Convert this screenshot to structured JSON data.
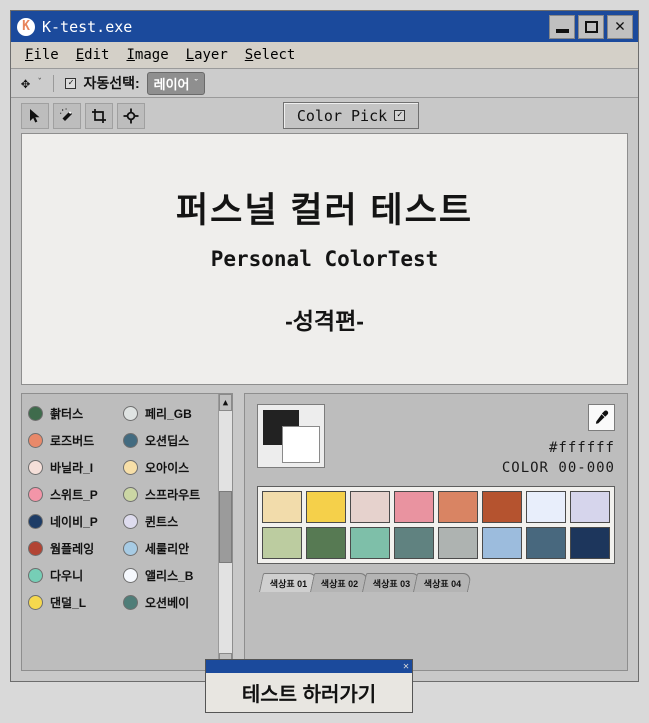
{
  "window": {
    "title": "K-test.exe",
    "icon": "app-k-icon",
    "controls": {
      "minimize": "minimize-icon",
      "maximize": "maximize-icon",
      "close": "✕"
    }
  },
  "menubar": {
    "items": [
      {
        "mnemonic": "F",
        "rest": "ile"
      },
      {
        "mnemonic": "E",
        "rest": "dit"
      },
      {
        "mnemonic": "I",
        "rest": "mage"
      },
      {
        "mnemonic": "L",
        "rest": "ayer"
      },
      {
        "mnemonic": "S",
        "rest": "elect"
      }
    ]
  },
  "options_bar": {
    "move_tool_icon": "move-icon",
    "caret": "ˇ",
    "checkbox_glyph": "☑",
    "auto_select_label": "자동선택:",
    "layer_dropdown_value": "레이어",
    "layer_dropdown_caret": "ˇ"
  },
  "toolbar": {
    "tools": [
      {
        "name": "move-arrow-tool",
        "icon": "arrow-cursor-icon"
      },
      {
        "name": "magic-wand-tool",
        "icon": "magic-wand-icon"
      },
      {
        "name": "crop-tool",
        "icon": "crop-icon"
      },
      {
        "name": "target-tool",
        "icon": "target-crosshair-icon"
      }
    ],
    "color_pick": {
      "label": "Color Pick",
      "checkbox_glyph": "☑"
    }
  },
  "canvas": {
    "title": "퍼스널 컬러 테스트",
    "subtitle": "Personal ColorTest",
    "section": "-성격편-"
  },
  "color_list": {
    "left_column": [
      {
        "name": "촭터스",
        "color": "#3f6b4c"
      },
      {
        "name": "로즈버드",
        "color": "#e8896a"
      },
      {
        "name": "바닐라_I",
        "color": "#f5dfd9"
      },
      {
        "name": "스위트_P",
        "color": "#f395a8"
      },
      {
        "name": "네이비_P",
        "color": "#1d3c66"
      },
      {
        "name": "웜플레잉",
        "color": "#b24434"
      },
      {
        "name": "다우니",
        "color": "#76ceb6"
      },
      {
        "name": "댄덜_L",
        "color": "#f5d84e"
      }
    ],
    "right_column": [
      {
        "name": "페리_GB",
        "color": "#dfe3e2"
      },
      {
        "name": "오션딥스",
        "color": "#436b80"
      },
      {
        "name": "오아이스",
        "color": "#f7dfa8"
      },
      {
        "name": "스프라우트",
        "color": "#cbd6a4"
      },
      {
        "name": "퀸트스",
        "color": "#dedcee"
      },
      {
        "name": "세룰리안",
        "color": "#a7cbe4"
      },
      {
        "name": "앨리스_B",
        "color": "#f5f8fd"
      },
      {
        "name": "오션베이",
        "color": "#4f7d78"
      }
    ],
    "scrollbar": {
      "up_arrow": "▲",
      "down_arrow": "▼"
    }
  },
  "color_picker": {
    "foreground": "#222222",
    "background": "#ffffff",
    "eyedropper_icon": "eyedropper-icon",
    "hex_value": "#ffffff",
    "color_number": "COLOR 00-000",
    "swatches": [
      "#f2dcab",
      "#f5d04a",
      "#e6d2cd",
      "#e993a0",
      "#d98463",
      "#b5532f",
      "#e8eefb",
      "#d6d5ec",
      "#bcccA0",
      "#577a53",
      "#7ebfa9",
      "#608280",
      "#aeb3b1",
      "#9cbcdd",
      "#48687e",
      "#1d365c"
    ],
    "tabs": [
      {
        "label": "색상표 01",
        "active": true
      },
      {
        "label": "색상표 02",
        "active": false
      },
      {
        "label": "색상표 03",
        "active": false
      },
      {
        "label": "색상표 04",
        "active": false
      }
    ]
  },
  "popup": {
    "close_glyph": "✕",
    "button_label": "테스트 하러가기"
  }
}
